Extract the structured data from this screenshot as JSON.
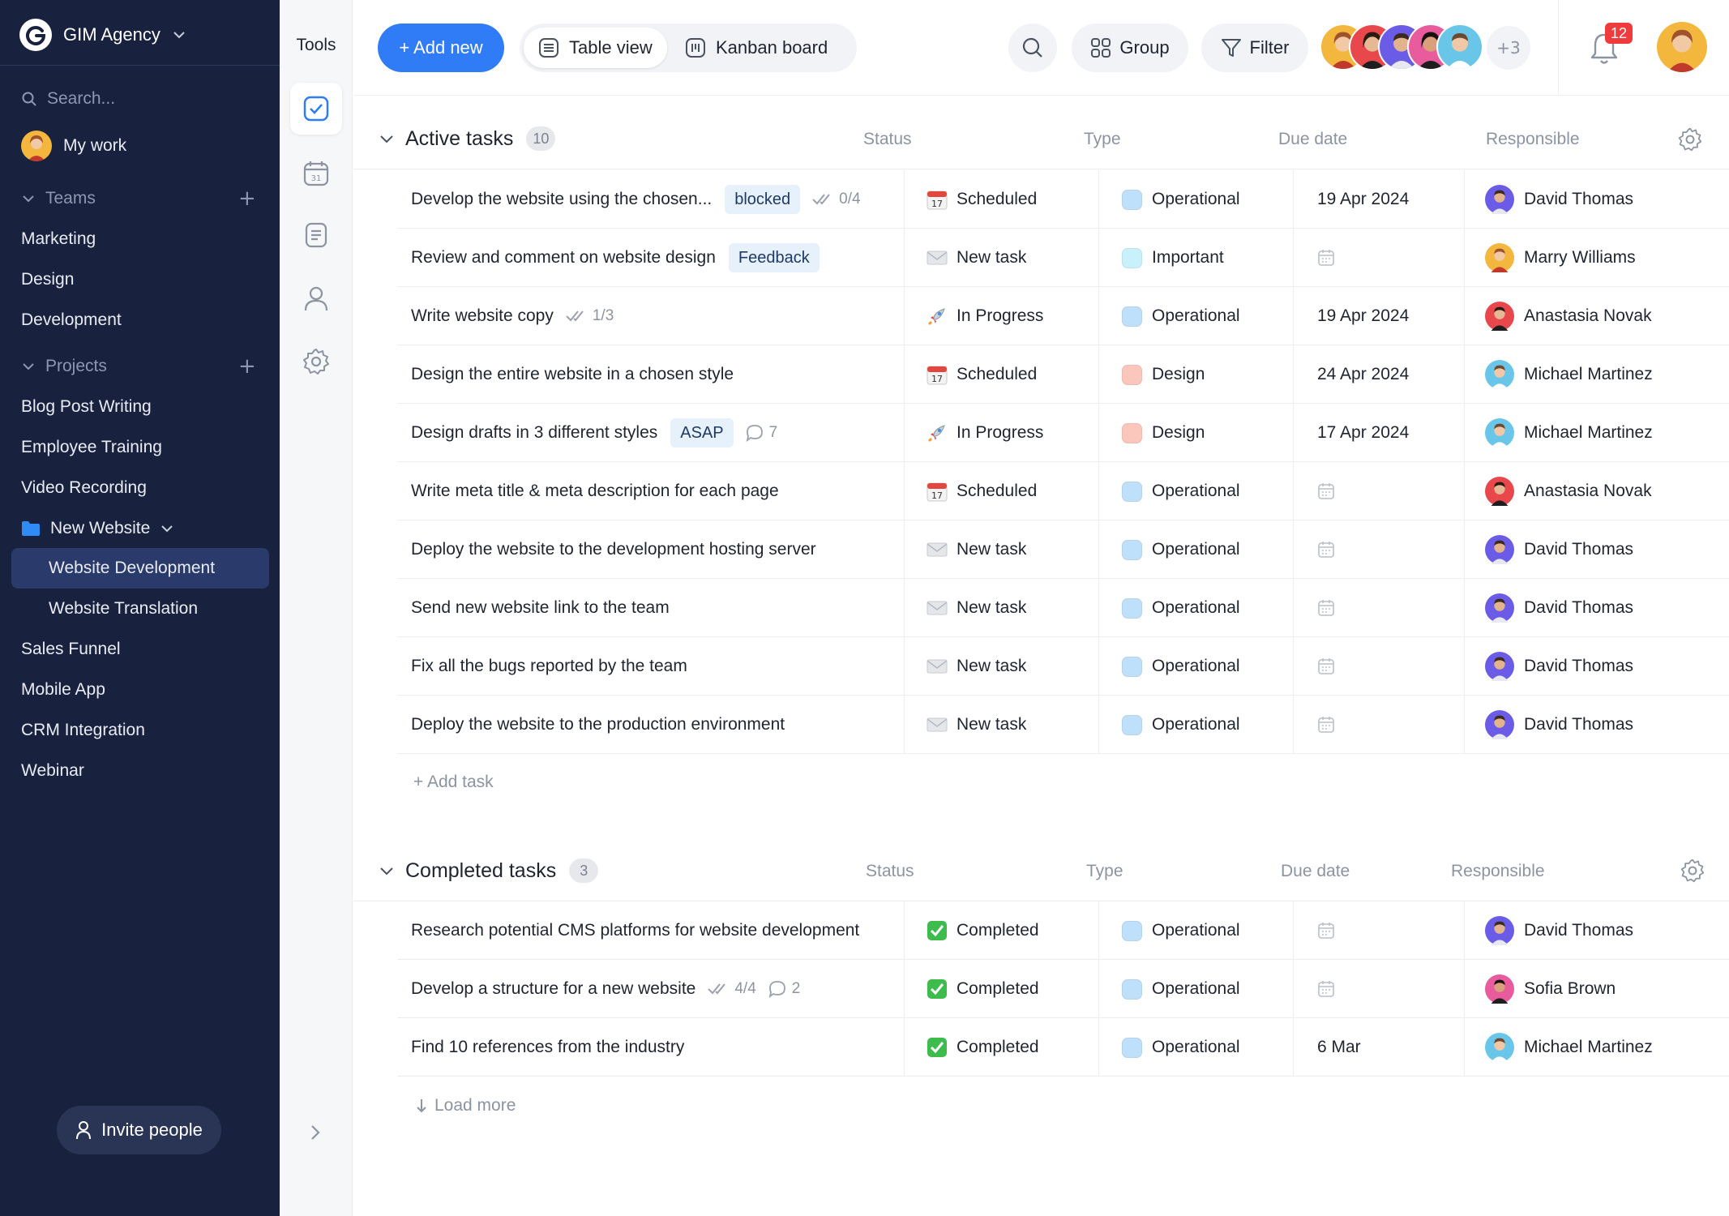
{
  "workspace": {
    "name": "GIM Agency"
  },
  "sidebar": {
    "search_placeholder": "Search...",
    "my_work": "My work",
    "teams_label": "Teams",
    "teams": [
      "Marketing",
      "Design",
      "Development"
    ],
    "projects_label": "Projects",
    "projects": [
      "Blog Post Writing",
      "Employee Training",
      "Video Recording"
    ],
    "folder": "New Website",
    "folder_children": [
      "Website Development",
      "Website Translation"
    ],
    "projects_more": [
      "Sales Funnel",
      "Mobile App",
      "CRM Integration",
      "Webinar"
    ],
    "invite": "Invite people"
  },
  "tools": {
    "title": "Tools"
  },
  "header": {
    "add_new": "+ Add new",
    "table_view": "Table view",
    "kanban_board": "Kanban board",
    "group": "Group",
    "filter": "Filter",
    "members_more": "+3",
    "notifications_count": "12"
  },
  "columns": {
    "status": "Status",
    "type": "Type",
    "due": "Due date",
    "responsible": "Responsible"
  },
  "active": {
    "title": "Active tasks",
    "count": "10",
    "add_task": "+ Add task",
    "tasks": [
      {
        "name": "Develop the website using the chosen...",
        "tag": "blocked",
        "checks": "0/4",
        "comments": "",
        "status": "Scheduled",
        "type": "Operational",
        "due": "19 Apr 2024",
        "resp": "David Thomas"
      },
      {
        "name": "Review and comment on website design",
        "tag": "Feedback",
        "checks": "",
        "comments": "",
        "status": "New task",
        "type": "Important",
        "due": "",
        "resp": "Marry Williams"
      },
      {
        "name": "Write website copy",
        "tag": "",
        "checks": "1/3",
        "comments": "",
        "status": "In Progress",
        "type": "Operational",
        "due": "19 Apr 2024",
        "resp": "Anastasia Novak"
      },
      {
        "name": "Design the entire website in a chosen style",
        "tag": "",
        "checks": "",
        "comments": "",
        "status": "Scheduled",
        "type": "Design",
        "due": "24 Apr 2024",
        "resp": "Michael Martinez"
      },
      {
        "name": "Design drafts in 3 different styles",
        "tag": "ASAP",
        "checks": "",
        "comments": "7",
        "status": "In Progress",
        "type": "Design",
        "due": "17 Apr 2024",
        "resp": "Michael Martinez"
      },
      {
        "name": "Write meta title & meta description for each page",
        "tag": "",
        "checks": "",
        "comments": "",
        "status": "Scheduled",
        "type": "Operational",
        "due": "",
        "resp": "Anastasia Novak"
      },
      {
        "name": "Deploy the website to the development hosting server",
        "tag": "",
        "checks": "",
        "comments": "",
        "status": "New task",
        "type": "Operational",
        "due": "",
        "resp": "David Thomas"
      },
      {
        "name": "Send new website link to the team",
        "tag": "",
        "checks": "",
        "comments": "",
        "status": "New task",
        "type": "Operational",
        "due": "",
        "resp": "David Thomas"
      },
      {
        "name": "Fix all the bugs reported by the team",
        "tag": "",
        "checks": "",
        "comments": "",
        "status": "New task",
        "type": "Operational",
        "due": "",
        "resp": "David Thomas"
      },
      {
        "name": "Deploy the website to the production environment",
        "tag": "",
        "checks": "",
        "comments": "",
        "status": "New task",
        "type": "Operational",
        "due": "",
        "resp": "David Thomas"
      }
    ]
  },
  "completed": {
    "title": "Completed tasks",
    "count": "3",
    "load_more": "Load more",
    "tasks": [
      {
        "name": "Research potential CMS platforms for website development",
        "tag": "",
        "checks": "",
        "comments": "",
        "status": "Completed",
        "type": "Operational",
        "due": "",
        "resp": "David Thomas"
      },
      {
        "name": "Develop a structure for a new website",
        "tag": "",
        "checks": "4/4",
        "comments": "2",
        "status": "Completed",
        "type": "Operational",
        "due": "",
        "resp": "Sofia Brown"
      },
      {
        "name": "Find 10 references from the industry",
        "tag": "",
        "checks": "",
        "comments": "",
        "status": "Completed",
        "type": "Operational",
        "due": "6 Mar",
        "resp": "Michael Martinez"
      }
    ]
  },
  "colors": {
    "sidebar_bg": "#18223f",
    "accent": "#2f7cf6",
    "type_operational": "#bfe0fb",
    "type_important": "#c9f1fb",
    "type_design": "#fbc6bb",
    "badge": "#ef3b3b"
  }
}
